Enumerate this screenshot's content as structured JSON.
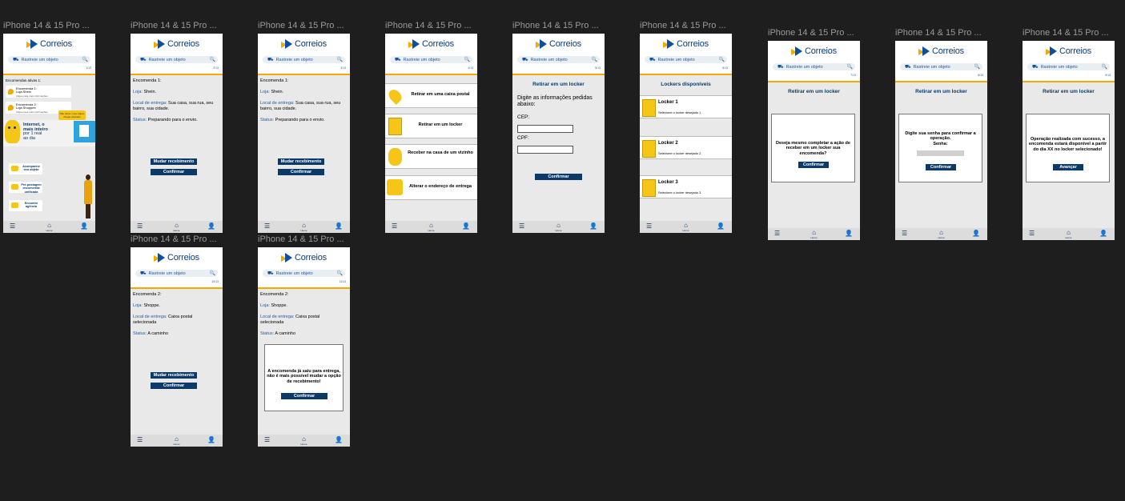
{
  "common": {
    "frame_title": "iPhone 14 & 15 Pro ...",
    "logo_text": "Correios",
    "search_placeholder": "Rastreie um objeto",
    "nav_home": "Home"
  },
  "frames": {
    "home": {
      "page": "1/13",
      "section_title": "Encomendas ativas 1:",
      "cards": [
        {
          "line1": "Encomenda 1:",
          "line2": "Loja Shein",
          "line3": "Clique para mais informações"
        },
        {
          "line1": "Encomenda 2:",
          "line2": "Loja Shoppee",
          "line3": "Clique para mais informações"
        }
      ],
      "banner": {
        "line1": "Internet, o",
        "line2": "mais inteiro",
        "line3": "por 1 real",
        "line4": "ao dia"
      },
      "tip": "Não deixe o seu objeto chegar atrasado",
      "services": [
        "Acompanhe seu objeto",
        "Pré-postagem encomenda unificada",
        "Encontre agência"
      ]
    },
    "enc1_a": {
      "page": "2/13",
      "title": "Encomenda 1:",
      "loja_label": "Loja:",
      "loja": "Shein.",
      "local_label": "Local de entrega:",
      "local": "Sua casa, sua rua, seu bairro, sua cidade.",
      "status_label": "Status:",
      "status": "Preparando para o envio.",
      "btn_mudar": "Mudar recebimento",
      "btn_confirmar": "Confirmar"
    },
    "enc1_b": {
      "page": "3/13",
      "title": "Encomenda 1:",
      "loja_label": "Loja:",
      "loja": "Shein.",
      "local_label": "Local de entrega:",
      "local": "Sua casa, sua rua, seu bairro, sua cidade.",
      "status_label": "Status:",
      "status": "Preparando para o envio.",
      "btn_mudar": "Mudar recebimento",
      "btn_confirmar": "Confirmar"
    },
    "opcoes": {
      "page": "4/13",
      "items": [
        "Retirar em uma caixa postal",
        "Retirar em um locker",
        "Receber na casa de um vizinho",
        "Alterar o endereço de entrega"
      ]
    },
    "locker_form": {
      "page": "5/13",
      "title": "Retirar em um locker",
      "intro": "Digite as informações pedidas abaixo:",
      "cep_label": "CEP:",
      "cpf_label": "CPF:",
      "btn_confirmar": "Confirmar"
    },
    "lockers": {
      "page": "6/13",
      "title": "Lockers disponíveis",
      "items": [
        {
          "name": "Locker 1",
          "hint": "Selecione o locker desejado 1."
        },
        {
          "name": "Locker 2",
          "hint": "Selecione o locker desejado 2."
        },
        {
          "name": "Locker 3",
          "hint": "Selecione o locker desejado 3."
        }
      ]
    },
    "confirm_locker": {
      "page": "7/13",
      "title": "Retirar em um locker",
      "message": "Deseja mesmo completar a ação de receber em um locker sua encomenda?",
      "btn": "Confirmar"
    },
    "password": {
      "page": "8/13",
      "title": "Retirar em um locker",
      "message": "Digite sua senha para confirmar a operação.",
      "label": "Senha:",
      "btn": "Confirmar"
    },
    "success": {
      "page": "9/13",
      "title": "Retirar em um locker",
      "message": "Operação realizada com sucesso, a encomenda estará disponível a partir do dia XX no locker selecionado!",
      "btn": "Avançar"
    },
    "enc2_a": {
      "page": "10/13",
      "title": "Encomenda 2:",
      "loja_label": "Loja:",
      "loja": "Shoppe.",
      "local_label": "Local de entrega:",
      "local": "Caixa postal selecionada",
      "status_label": "Status:",
      "status": "A caminho",
      "btn_mudar": "Mudar recebimento",
      "btn_confirmar": "Confirmar"
    },
    "enc2_b": {
      "page": "11/13",
      "title": "Encomenda 2:",
      "loja_label": "Loja:",
      "loja": "Shoppe.",
      "local_label": "Local de entrega:",
      "local": "Caixa postal selecionada",
      "status_label": "Status:",
      "status": "A caminho",
      "modal": "A encomenda já saiu para entrega, não é mais possível mudar a opção de recebimento!",
      "btn_confirmar": "Confirmar"
    }
  }
}
